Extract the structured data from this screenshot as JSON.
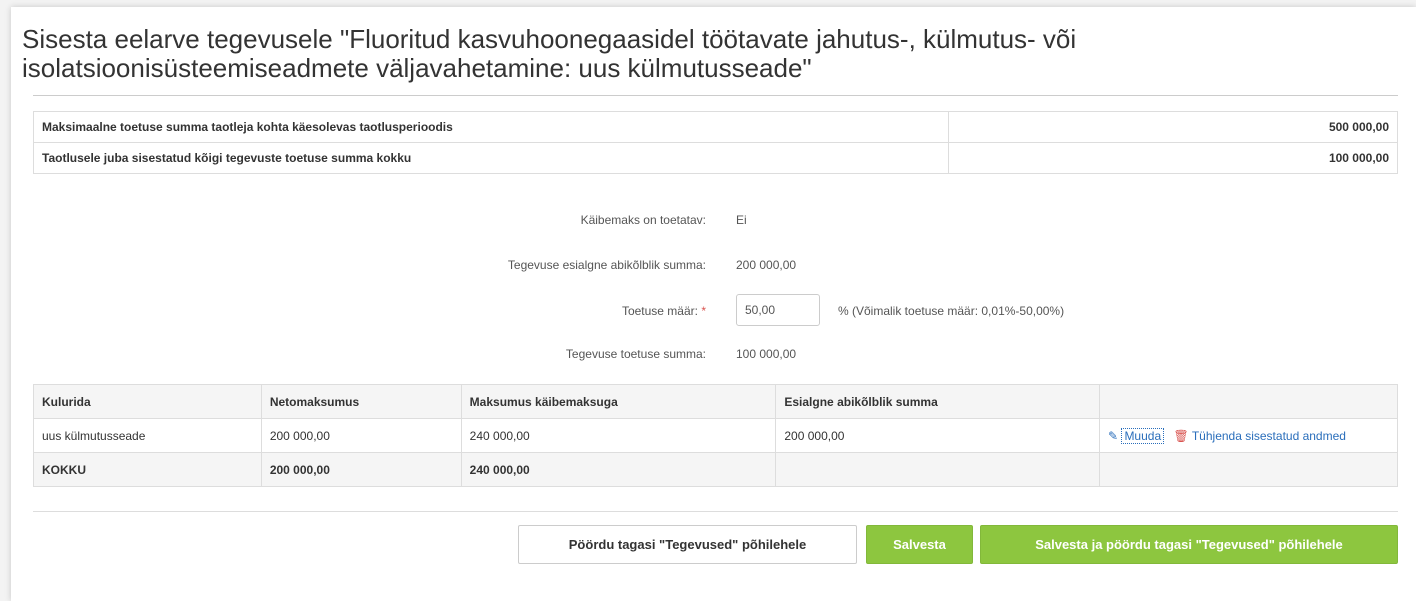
{
  "page": {
    "title": "Sisesta eelarve tegevusele \"Fluoritud kasvuhoonegaasidel töötavate jahutus-, külmutus- või isolatsioonisüsteemiseadmete väljavahetamine: uus külmutusseade\""
  },
  "summary": [
    {
      "label": "Maksimaalne toetuse summa taotleja kohta käesolevas taotlusperioodis",
      "value": "500 000,00"
    },
    {
      "label": "Taotlusele juba sisestatud kõigi tegevuste toetuse summa kokku",
      "value": "100 000,00"
    }
  ],
  "form": {
    "vat_label": "Käibemaks on toetatav:",
    "vat_value": "Ei",
    "initial_label": "Tegevuse esialgne abikõlblik summa:",
    "initial_value": "200 000,00",
    "rate_label": "Toetuse määr:",
    "rate_required": "*",
    "rate_value": "50,00",
    "rate_hint": "% (Võimalik toetuse määr: 0,01%-50,00%)",
    "grant_label": "Tegevuse toetuse summa:",
    "grant_value": "100 000,00"
  },
  "costs": {
    "headers": [
      "Kulurida",
      "Netomaksumus",
      "Maksumus käibemaksuga",
      "Esialgne abikõlblik summa",
      ""
    ],
    "rows": [
      {
        "item": "uus külmutusseade",
        "net": "200 000,00",
        "gross": "240 000,00",
        "eligible": "200 000,00",
        "edit": "Muuda",
        "clear": "Tühjenda sisestatud andmed"
      }
    ],
    "total": {
      "label": "KOKKU",
      "net": "200 000,00",
      "gross": "240 000,00"
    }
  },
  "buttons": {
    "back": "Pöördu tagasi \"Tegevused\" põhilehele",
    "save": "Salvesta",
    "save_back": "Salvesta ja pöördu tagasi \"Tegevused\" põhilehele"
  },
  "colors": {
    "accent_green": "#8dc63f",
    "link_blue": "#2a6ebb",
    "danger_red": "#d9534f"
  },
  "icons": {
    "edit": "pencil-icon",
    "clear": "trash-icon"
  }
}
